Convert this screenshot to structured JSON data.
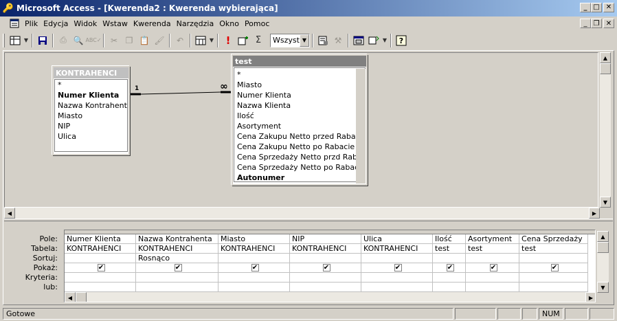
{
  "app": {
    "title": "Microsoft Access - [Kwerenda2 : Kwerenda wybierająca]"
  },
  "menu": {
    "items": [
      "Plik",
      "Edycja",
      "Widok",
      "Wstaw",
      "Kwerenda",
      "Narzędzia",
      "Okno",
      "Pomoc"
    ]
  },
  "toolbar": {
    "combo_value": "Wszystk"
  },
  "tables": {
    "kontrahenci": {
      "title": "KONTRAHENCI",
      "fields": [
        "*",
        "Numer Klienta",
        "Nazwa Kontrahenta",
        "Miasto",
        "NIP",
        "Ulica"
      ],
      "pk": "Numer Klienta"
    },
    "test": {
      "title": "test",
      "fields": [
        "*",
        "Miasto",
        "Numer Klienta",
        "Nazwa Klienta",
        "Ilość",
        "Asortyment",
        "Cena Zakupu Netto przed Rabatu",
        "Cena Zakupu Netto po Rabacie",
        "Cena Sprzedaży Netto przd Rabatu",
        "Cena Sprzedaży Netto po Rabacie",
        "Autonumer"
      ],
      "pk": "Autonumer"
    }
  },
  "join": {
    "left_label": "1",
    "right_label": "∞"
  },
  "grid": {
    "row_labels": [
      "Pole:",
      "Tabela:",
      "Sortuj:",
      "Pokaż:",
      "Kryteria:",
      "lub:"
    ],
    "columns": [
      {
        "field": "Numer Klienta",
        "table": "KONTRAHENCI",
        "sort": "",
        "show": true
      },
      {
        "field": "Nazwa Kontrahenta",
        "table": "KONTRAHENCI",
        "sort": "Rosnąco",
        "show": true
      },
      {
        "field": "Miasto",
        "table": "KONTRAHENCI",
        "sort": "",
        "show": true
      },
      {
        "field": "NIP",
        "table": "KONTRAHENCI",
        "sort": "",
        "show": true
      },
      {
        "field": "Ulica",
        "table": "KONTRAHENCI",
        "sort": "",
        "show": true
      },
      {
        "field": "Ilość",
        "table": "test",
        "sort": "",
        "show": true
      },
      {
        "field": "Asortyment",
        "table": "test",
        "sort": "",
        "show": true
      },
      {
        "field": "Cena Sprzedaży",
        "table": "test",
        "sort": "",
        "show": true
      }
    ]
  },
  "status": {
    "text": "Gotowe",
    "num": "NUM"
  },
  "icons": [
    "access-key-icon",
    "new-table-icon",
    "save-icon",
    "print-icon",
    "print-preview-icon",
    "spelling-icon",
    "cut-icon",
    "copy-icon",
    "paste-icon",
    "format-painter-icon",
    "undo-icon",
    "query-type-icon",
    "run-icon",
    "show-table-icon",
    "totals-icon",
    "properties-icon",
    "build-icon",
    "database-window-icon",
    "new-object-icon",
    "help-icon"
  ]
}
